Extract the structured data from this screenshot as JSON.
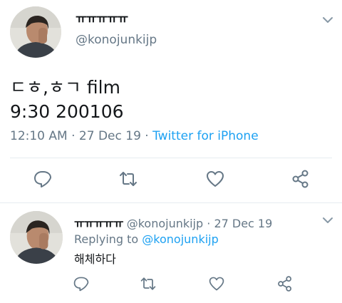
{
  "tweet": {
    "display_name": "ㅠㅠㅠㅠㅠ",
    "handle": "@konojunkijp",
    "text_line1": "ㄷㅎ,ㅎㄱ film",
    "text_line2": "9:30 200106",
    "time": "12:10 AM",
    "date": "27 Dec 19",
    "source": "Twitter for iPhone",
    "separator": "·"
  },
  "reply": {
    "display_name": "ㅠㅠㅠㅠㅠ",
    "handle": "@konojunkijp",
    "date": "27 Dec 19",
    "separator": "·",
    "replying_label": "Replying to",
    "replying_to": "@konojunkijp",
    "text": "해체하다"
  },
  "icons": {
    "reply": "reply-icon",
    "retweet": "retweet-icon",
    "like": "heart-icon",
    "share": "share-icon",
    "menu": "chevron-down-icon"
  },
  "colors": {
    "text": "#14171a",
    "secondary": "#657786",
    "link": "#1da1f2",
    "divider": "#e6ecf0"
  }
}
